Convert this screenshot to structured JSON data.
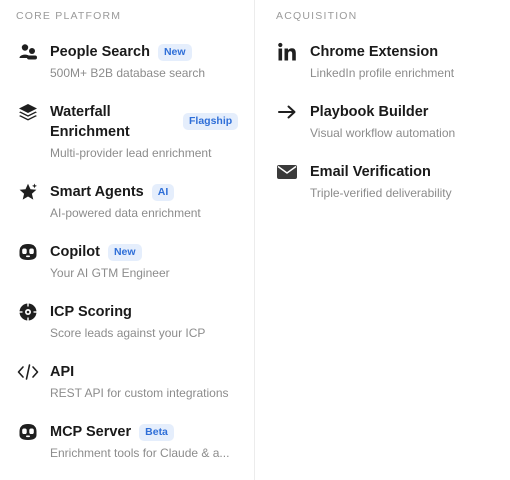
{
  "core": {
    "section_title": "CORE PLATFORM",
    "items": [
      {
        "title": "People Search",
        "badge": "New",
        "desc": "500M+ B2B database search",
        "icon": "people-icon"
      },
      {
        "title": "Waterfall Enrichment",
        "badge": "Flagship",
        "desc": "Multi-provider lead enrichment",
        "icon": "layers-icon"
      },
      {
        "title": "Smart Agents",
        "badge": "AI",
        "desc": "AI-powered data enrichment",
        "icon": "sparkle-star-icon"
      },
      {
        "title": "Copilot",
        "badge": "New",
        "desc": "Your AI GTM Engineer",
        "icon": "copilot-icon"
      },
      {
        "title": "ICP Scoring",
        "badge": "",
        "desc": "Score leads against your ICP",
        "icon": "target-icon"
      },
      {
        "title": "API",
        "badge": "",
        "desc": "REST API for custom integrations",
        "icon": "code-icon"
      },
      {
        "title": "MCP Server",
        "badge": "Beta",
        "desc": "Enrichment tools for Claude & a...",
        "icon": "mcp-icon"
      }
    ]
  },
  "acquisition": {
    "section_title": "ACQUISITION",
    "items": [
      {
        "title": "Chrome Extension",
        "desc": "LinkedIn profile enrichment",
        "icon": "linkedin-icon"
      },
      {
        "title": "Playbook Builder",
        "desc": "Visual workflow automation",
        "icon": "arrow-right-icon"
      },
      {
        "title": "Email Verification",
        "desc": "Triple-verified deliverability",
        "icon": "envelope-icon"
      }
    ]
  }
}
